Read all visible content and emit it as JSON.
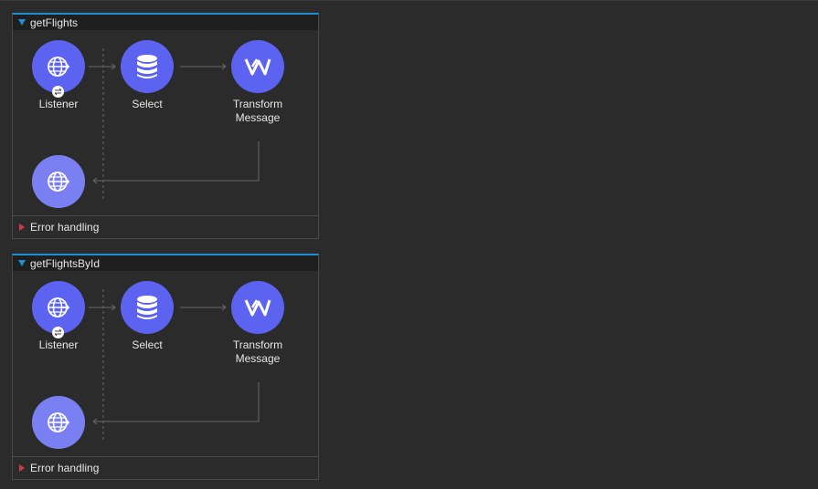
{
  "flows": [
    {
      "name": "getFlights",
      "nodes": {
        "listener": {
          "label": "Listener",
          "icon": "globe-arrow-icon"
        },
        "select": {
          "label": "Select",
          "icon": "database-icon"
        },
        "transform": {
          "label": "Transform\nMessage",
          "icon": "transform-icon"
        },
        "response": {
          "icon": "globe-arrow-icon"
        }
      },
      "error_handling": "Error handling"
    },
    {
      "name": "getFlightsById",
      "nodes": {
        "listener": {
          "label": "Listener",
          "icon": "globe-arrow-icon"
        },
        "select": {
          "label": "Select",
          "icon": "database-icon"
        },
        "transform": {
          "label": "Transform\nMessage",
          "icon": "transform-icon"
        },
        "response": {
          "icon": "globe-arrow-icon"
        }
      },
      "error_handling": "Error handling"
    }
  ],
  "colors": {
    "accent": "#1e8fd6",
    "node": "#5c63f0",
    "response_node": "#7a80f2",
    "error_marker": "#d23c4a"
  }
}
